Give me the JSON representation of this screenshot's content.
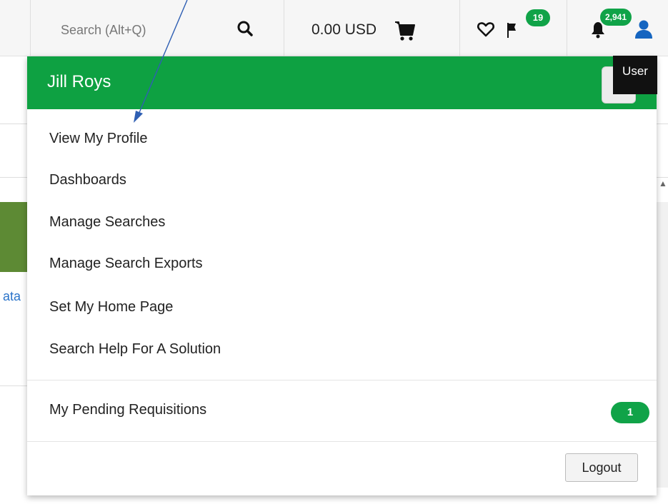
{
  "topbar": {
    "search_placeholder": "Search (Alt+Q)",
    "cart_amount": "0.00 USD",
    "flag_badge": "19",
    "notifications_badge": "2,941"
  },
  "user_menu": {
    "username": "Jill Roys",
    "tooltip": "User",
    "items": [
      {
        "label": "View My Profile"
      },
      {
        "label": "Dashboards"
      },
      {
        "label": "Manage Searches"
      },
      {
        "label": "Manage Search Exports"
      },
      {
        "label": "Set My Home Page"
      },
      {
        "label": "Search Help For A Solution"
      }
    ],
    "pending": {
      "label": "My Pending Requisitions",
      "count": "1"
    },
    "logout_label": "Logout"
  },
  "background": {
    "link_fragment": "ata"
  },
  "colors": {
    "brand_green": "#0ea142",
    "badge_green": "#10a348",
    "annotation_arrow": "#2f5fb3"
  }
}
